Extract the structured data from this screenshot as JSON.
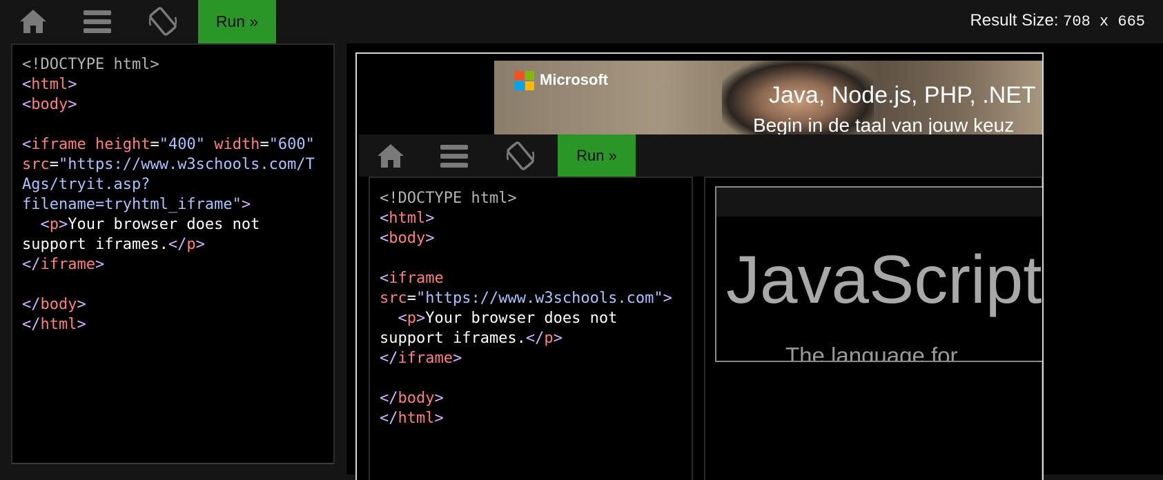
{
  "toolbar": {
    "home_icon": "home-icon",
    "menu_icon": "hamburger-menu-icon",
    "rotate_icon": "rotate-screen-icon",
    "run_label": "Run »",
    "result_size_label": "Result Size:",
    "result_size_value": "708 x 665"
  },
  "colors": {
    "run_button": "#2a9628",
    "background": "#151515",
    "editor_bg": "#000000",
    "tag_color": "#ff7f7f",
    "value_color": "#a9c3ff",
    "bracket_color": "#d9b3ff"
  },
  "editor": {
    "lines": [
      "<!DOCTYPE html>",
      "<html>",
      "<body>",
      "",
      "<iframe height=\"400\" width=\"600\"",
      "src=\"https://www.w3schools.com/T",
      "Ags/tryit.asp?",
      "filename=tryhtml_iframe\">",
      "  <p>Your browser does not",
      "support iframes.</p>",
      "</iframe>",
      "",
      "</body>",
      "</html>"
    ]
  },
  "result": {
    "ad": {
      "brand": "Microsoft",
      "headline": "Java, Node.js, PHP, .NET",
      "subline": "Begin in de taal van jouw keuz"
    },
    "inner_toolbar": {
      "run_label": "Run »"
    },
    "inner_editor": {
      "lines": [
        "<!DOCTYPE html>",
        "<html>",
        "<body>",
        "",
        "<iframe",
        "src=\"https://www.w3schools.com\">",
        "  <p>Your browser does not",
        "support iframes.</p>",
        "</iframe>",
        "",
        "</body>",
        "</html>"
      ]
    },
    "inner_frame": {
      "title": "JavaScript",
      "subtitle": "The language for"
    }
  }
}
